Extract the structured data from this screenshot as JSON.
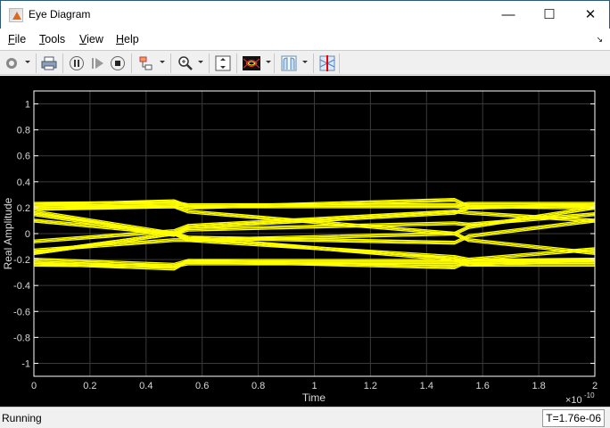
{
  "window": {
    "title": "Eye Diagram"
  },
  "menu": [
    {
      "label": "File",
      "key": "F",
      "rest": "ile"
    },
    {
      "label": "Tools",
      "key": "T",
      "rest": "ools"
    },
    {
      "label": "View",
      "key": "V",
      "rest": "iew"
    },
    {
      "label": "Help",
      "key": "H",
      "rest": "elp"
    }
  ],
  "status": {
    "text": "Running",
    "time": "T=1.76e-06"
  },
  "chart_data": {
    "type": "line",
    "title": "",
    "xlabel": "Time",
    "ylabel": "Real Amplitude",
    "x_exponent": "×10",
    "x_exponent_power": "-10",
    "xlim": [
      0,
      2
    ],
    "ylim": [
      -1.1,
      1.1
    ],
    "xticks": [
      "0",
      "0.2",
      "0.4",
      "0.6",
      "0.8",
      "1",
      "1.2",
      "1.4",
      "1.6",
      "1.8",
      "2"
    ],
    "yticks": [
      "1",
      "0.8",
      "0.6",
      "0.4",
      "0.2",
      "0",
      "-0.2",
      "-0.4",
      "-0.6",
      "-0.8",
      "-1"
    ],
    "grid": true,
    "trace_color": "#ffff00",
    "x": [
      0,
      0.5,
      0.55,
      1.5,
      1.55,
      2
    ],
    "series": [
      {
        "name": "trace",
        "values": [
          0.22,
          0.25,
          0.21,
          0.21,
          0.2,
          0.22
        ]
      },
      {
        "name": "trace",
        "values": [
          0.19,
          0.21,
          0.2,
          0.26,
          0.21,
          0.2
        ]
      },
      {
        "name": "trace",
        "values": [
          0.17,
          0.0,
          -0.03,
          -0.07,
          -0.02,
          0.1
        ]
      },
      {
        "name": "trace",
        "values": [
          0.15,
          -0.01,
          0.05,
          0.16,
          0.2,
          0.22
        ]
      },
      {
        "name": "trace",
        "values": [
          -0.15,
          0.0,
          0.03,
          0.08,
          0.07,
          0.15
        ]
      },
      {
        "name": "trace",
        "values": [
          -0.15,
          0.0,
          -0.03,
          -0.2,
          -0.24,
          -0.2
        ]
      },
      {
        "name": "trace",
        "values": [
          -0.2,
          -0.24,
          -0.21,
          -0.21,
          -0.21,
          -0.21
        ]
      },
      {
        "name": "trace",
        "values": [
          -0.23,
          -0.27,
          -0.21,
          -0.26,
          -0.21,
          -0.2
        ]
      },
      {
        "name": "trace",
        "values": [
          0.2,
          0.21,
          0.17,
          0.0,
          -0.05,
          -0.15
        ]
      },
      {
        "name": "trace",
        "values": [
          -0.13,
          -0.05,
          -0.05,
          0.0,
          0.05,
          0.2
        ]
      },
      {
        "name": "trace",
        "values": [
          0.1,
          0.0,
          -0.05,
          -0.18,
          -0.2,
          -0.12
        ]
      },
      {
        "name": "trace",
        "values": [
          -0.06,
          0.02,
          0.06,
          0.17,
          0.16,
          0.1
        ]
      },
      {
        "name": "trace",
        "values": [
          0.23,
          0.24,
          0.22,
          0.22,
          0.23,
          0.23
        ]
      },
      {
        "name": "trace",
        "values": [
          -0.24,
          -0.25,
          -0.23,
          -0.23,
          -0.24,
          -0.24
        ]
      }
    ]
  }
}
